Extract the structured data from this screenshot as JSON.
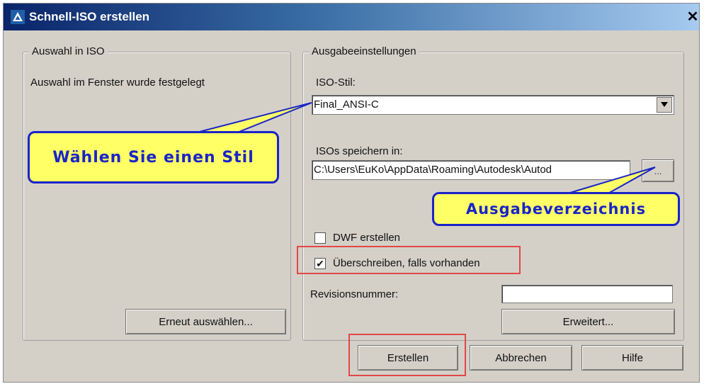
{
  "window": {
    "title": "Schnell-ISO erstellen",
    "close_label": "✕"
  },
  "selection_group": {
    "legend": "Auswahl in ISO",
    "status_text": "Auswahl im Fenster wurde festgelegt",
    "reselect_button": "Erneut auswählen..."
  },
  "output_group": {
    "legend": "Ausgabeeinstellungen",
    "iso_style_label": "ISO-Stil:",
    "iso_style_value": "Final_ANSI-C",
    "save_label": "ISOs speichern in:",
    "save_path": "C:\\Users\\EuKo\\AppData\\Roaming\\Autodesk\\Autod",
    "browse_button": "...",
    "dwf_label": "DWF erstellen",
    "dwf_checked": false,
    "overwrite_label": "Überschreiben, falls vorhanden",
    "overwrite_checked": true,
    "revision_label": "Revisionsnummer:",
    "revision_value": "",
    "advanced_button": "Erweitert..."
  },
  "callouts": {
    "style_hint": "Wählen Sie einen Stil",
    "output_hint": "Ausgabeverzeichnis"
  },
  "footer": {
    "create_button": "Erstellen",
    "cancel_button": "Abbrechen",
    "help_button": "Hilfe"
  },
  "colors": {
    "callout_fill": "#ffff66",
    "callout_border": "#1a24c8",
    "highlight_border": "#e04848",
    "titlebar_start": "#0a246a"
  },
  "icons": {
    "app": "autodesk-triangle-icon",
    "dropdown": "chevron-down-icon",
    "check": "check-icon"
  }
}
